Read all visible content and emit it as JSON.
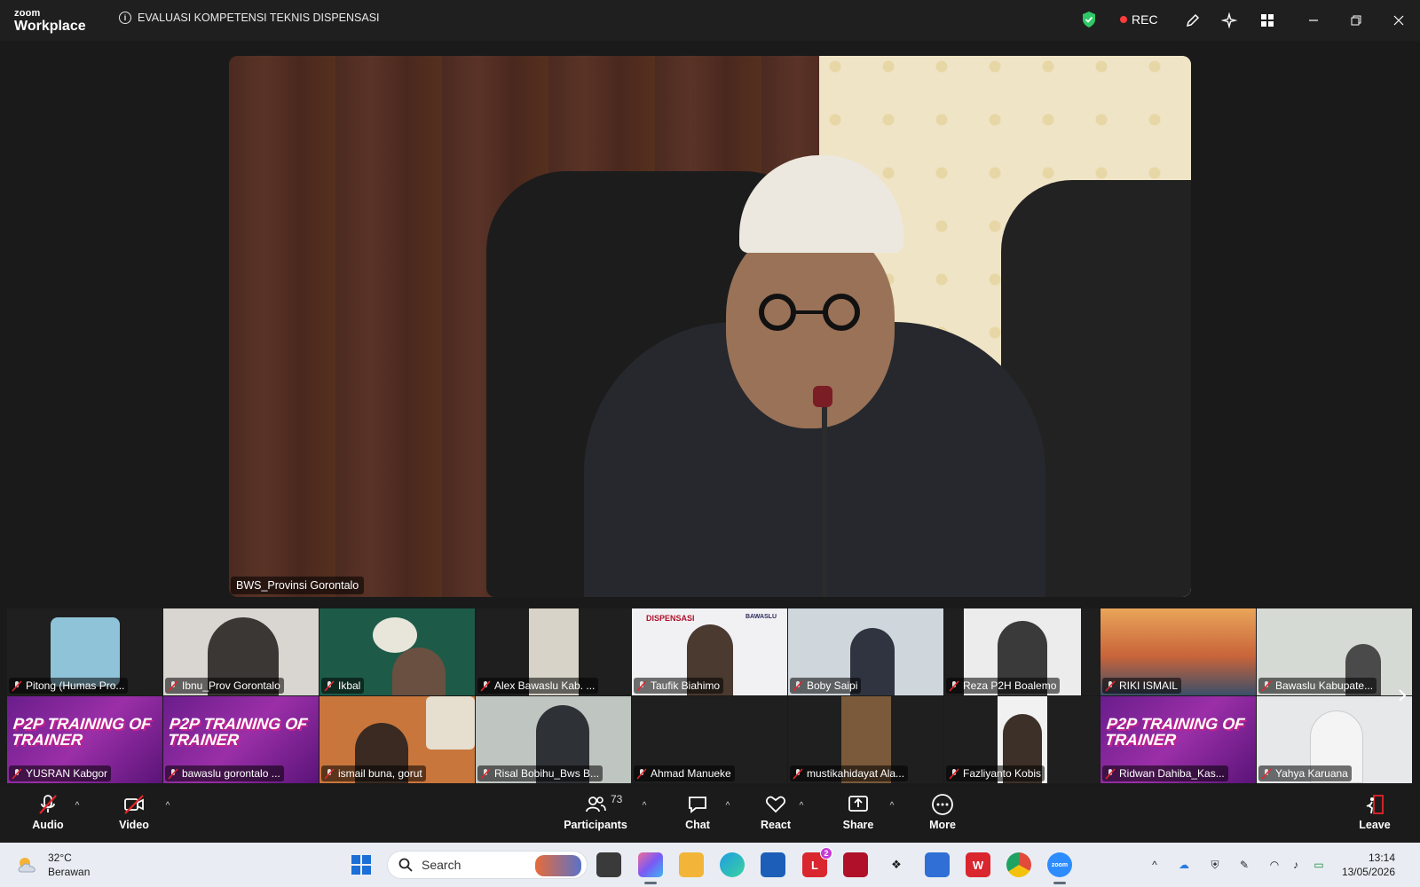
{
  "app": {
    "brand_top": "zoom",
    "brand_bottom": "Workplace",
    "meeting_title": "EVALUASI KOMPETENSI TEKNIS DISPENSASI",
    "rec_label": "REC",
    "accent_green": "#2ec866",
    "rec_red": "#ff3b3b"
  },
  "main_video": {
    "name": "BWS_Provinsi Gorontalo"
  },
  "gallery": {
    "row1": [
      {
        "name": "Pitong (Humas Pro...",
        "muted": true
      },
      {
        "name": "Ibnu_Prov Gorontalo",
        "muted": true
      },
      {
        "name": "Ikbal",
        "muted": true
      },
      {
        "name": "Alex Bawaslu Kab. ...",
        "muted": true
      },
      {
        "name": "Taufik Biahimo",
        "muted": true
      },
      {
        "name": "Boby Saipi",
        "muted": true
      },
      {
        "name": "Reza P2H Boalemo",
        "muted": true
      },
      {
        "name": "RIKI ISMAIL",
        "muted": true
      },
      {
        "name": "Bawaslu Kabupate...",
        "muted": true
      }
    ],
    "row2": [
      {
        "name": "YUSRAN Kabgor",
        "muted": true
      },
      {
        "name": "bawaslu gorontalo ...",
        "muted": true
      },
      {
        "name": "ismail buna, gorut",
        "muted": true
      },
      {
        "name": "Risal Bobihu_Bws B...",
        "muted": true
      },
      {
        "name": "Ahmad Manueke",
        "muted": true
      },
      {
        "name": "mustikahidayat Ala...",
        "muted": true
      },
      {
        "name": "Fazliyanto Kobis",
        "muted": true
      },
      {
        "name": "Ridwan Dahiba_Kas...",
        "muted": true
      },
      {
        "name": "Yahya Karuana",
        "muted": true
      }
    ],
    "banner_text": "P2P TRAINING OF TRAINER",
    "banner_small": "BAWASLU",
    "dispensasi_label": "DISPENSASI",
    "next_icon": "chevron-right-icon"
  },
  "toolbar": {
    "audio_label": "Audio",
    "video_label": "Video",
    "participants_label": "Participants",
    "participants_count": "73",
    "chat_label": "Chat",
    "react_label": "React",
    "share_label": "Share",
    "more_label": "More",
    "leave_label": "Leave",
    "leave_red": "#e5242b"
  },
  "taskbar": {
    "temperature": "32°C",
    "weather": "Berawan",
    "search_placeholder": "Search",
    "time": "13:14",
    "date": "13/05/2026",
    "notification_count": "2",
    "zoom_app_label": "zoom"
  }
}
